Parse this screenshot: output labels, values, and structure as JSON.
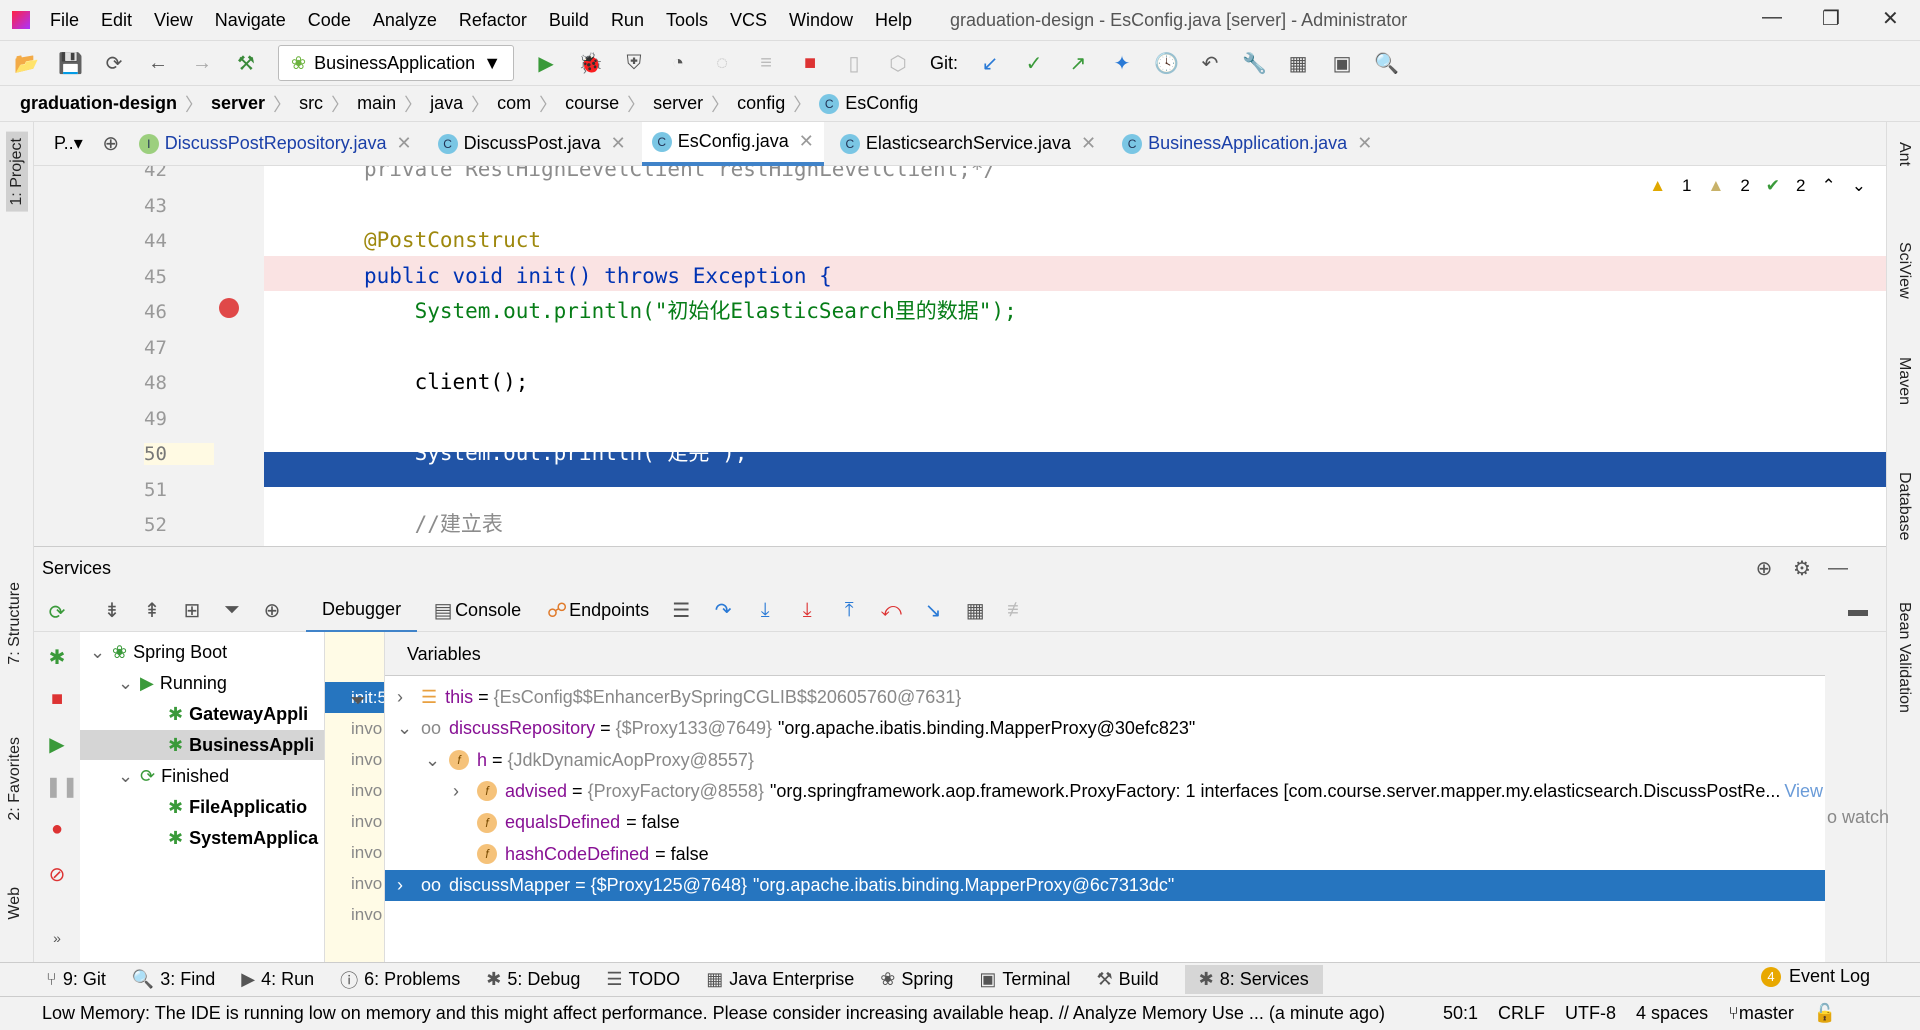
{
  "menubar": {
    "items": [
      "File",
      "Edit",
      "View",
      "Navigate",
      "Code",
      "Analyze",
      "Refactor",
      "Build",
      "Run",
      "Tools",
      "VCS",
      "Window",
      "Help"
    ],
    "title": "graduation-design - EsConfig.java [server] - Administrator"
  },
  "toolbar": {
    "run_config": "BusinessApplication",
    "git_label": "Git:"
  },
  "breadcrumb": [
    "graduation-design",
    "server",
    "src",
    "main",
    "java",
    "com",
    "course",
    "server",
    "config",
    "EsConfig"
  ],
  "project_tab": "P..▾",
  "tabs": [
    {
      "label": "DiscussPostRepository.java",
      "icon": "interface-icon"
    },
    {
      "label": "DiscussPost.java",
      "icon": "class-icon"
    },
    {
      "label": "EsConfig.java",
      "icon": "class-icon",
      "active": true
    },
    {
      "label": "ElasticsearchService.java",
      "icon": "class-icon"
    },
    {
      "label": "BusinessApplication.java",
      "icon": "spring-class-icon"
    }
  ],
  "inspections": {
    "warnings": "1",
    "weak_warnings": "2",
    "typos": "2"
  },
  "editor": {
    "current_line": 50,
    "breakpoint_line": 46,
    "lines": [
      {
        "n": "42",
        "text": "private RestHighLevelClient restHighLevelClient;*/"
      },
      {
        "n": "43",
        "text": ""
      },
      {
        "n": "44",
        "text": "@PostConstruct"
      },
      {
        "n": "45",
        "text": "public void init() throws Exception {"
      },
      {
        "n": "46",
        "text": "    System.out.println(\"初始化ElasticSearch里的数据\");"
      },
      {
        "n": "47",
        "text": ""
      },
      {
        "n": "48",
        "text": "    client();"
      },
      {
        "n": "49",
        "text": ""
      },
      {
        "n": "50",
        "text": "    System.out.println(\"走完\");"
      },
      {
        "n": "51",
        "text": ""
      },
      {
        "n": "52",
        "text": "    //建立表"
      }
    ]
  },
  "services": {
    "title": "Services",
    "tabs": [
      "Debugger",
      "Console",
      "Endpoints"
    ],
    "tree": [
      {
        "label": "Spring Boot",
        "level": 0
      },
      {
        "label": "Running",
        "level": 1
      },
      {
        "label": "GatewayAppli",
        "level": 2
      },
      {
        "label": "BusinessAppli",
        "level": 2,
        "selected": true
      },
      {
        "label": "Finished",
        "level": 1
      },
      {
        "label": "FileApplicatio",
        "level": 2
      },
      {
        "label": "SystemApplica",
        "level": 2
      }
    ],
    "frames": [
      "init:5",
      "invo",
      "invo",
      "invo",
      "invo",
      "invo",
      "invo",
      "invo"
    ],
    "variables_title": "Variables",
    "variables": [
      {
        "name": "this",
        "type": "{EsConfig$$EnhancerBySpringCGLIB$$20605760@7631}",
        "value": "",
        "level": 0,
        "arrow": "›"
      },
      {
        "name": "discussRepository",
        "type": "{$Proxy133@7649}",
        "value": "\"org.apache.ibatis.binding.MapperProxy@30efc823\"",
        "level": 0,
        "arrow": "⌄"
      },
      {
        "name": "h",
        "type": "{JdkDynamicAopProxy@8557}",
        "value": "",
        "level": 1,
        "arrow": "⌄"
      },
      {
        "name": "advised",
        "type": "{ProxyFactory@8558}",
        "value": "\"org.springframework.aop.framework.ProxyFactory: 1 interfaces [com.course.server.mapper.my.elasticsearch.DiscussPostRe...",
        "level": 2,
        "arrow": "›",
        "link": "View"
      },
      {
        "name": "equalsDefined",
        "type": "",
        "value": "= false",
        "level": 2,
        "arrow": ""
      },
      {
        "name": "hashCodeDefined",
        "type": "",
        "value": "= false",
        "level": 2,
        "arrow": ""
      },
      {
        "name": "discussMapper",
        "type": "{$Proxy125@7648}",
        "value": "\"org.apache.ibatis.binding.MapperProxy@6c7313dc\"",
        "level": 0,
        "arrow": "›",
        "selected": true
      }
    ],
    "watch_hint": "o watch"
  },
  "left_stripe": [
    "1: Project",
    "7: Structure",
    "2: Favorites",
    "Web"
  ],
  "right_stripe": [
    "Ant",
    "SciView",
    "Maven",
    "Database",
    "Bean Validation"
  ],
  "bottom_tools": [
    "9: Git",
    "3: Find",
    "4: Run",
    "6: Problems",
    "5: Debug",
    "TODO",
    "Java Enterprise",
    "Spring",
    "Terminal",
    "Build",
    "8: Services"
  ],
  "event_log": {
    "count": "4",
    "label": "Event Log"
  },
  "status": {
    "message": "Low Memory: The IDE is running low on memory and this might affect performance. Please consider increasing available heap. // Analyze Memory Use ... (a minute ago)",
    "position": "50:1",
    "line_sep": "CRLF",
    "encoding": "UTF-8",
    "indent": "4 spaces",
    "branch": "master"
  },
  "colors": {
    "accent": "#2675bf",
    "current_line": "#2154a6",
    "breakpoint_line": "#fae3e3"
  }
}
